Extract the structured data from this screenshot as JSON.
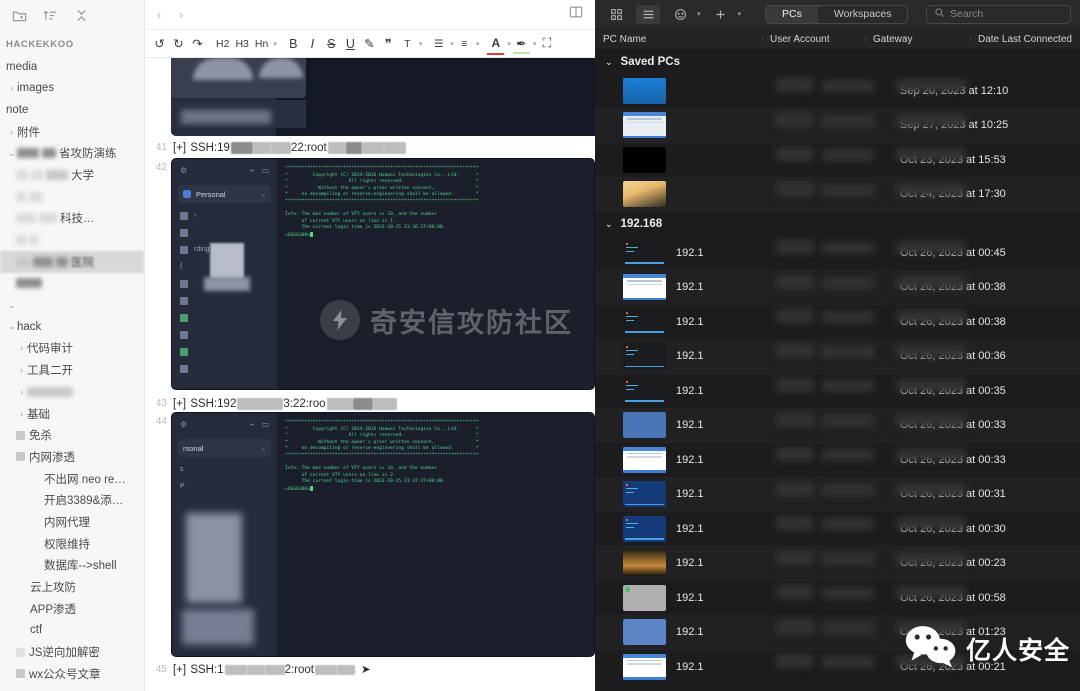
{
  "sidebar": {
    "toolbar_icons": [
      "new-note-icon",
      "sort-icon",
      "collapse-all-icon"
    ],
    "vault_name": "HACKEKKOO",
    "items": [
      {
        "label": "media",
        "depth": 0,
        "chevron": "",
        "kind": "folder"
      },
      {
        "label": "images",
        "depth": 0,
        "chevron": "›",
        "kind": "folder"
      },
      {
        "label": "note",
        "depth": 0,
        "chevron": "",
        "kind": "folder"
      },
      {
        "label": "附件",
        "depth": 0,
        "chevron": "›",
        "kind": "folder"
      },
      {
        "label": "省攻防演练",
        "depth": 0,
        "chevron": "⌄",
        "kind": "folder",
        "redacted_prefix": true
      },
      {
        "label": "大学",
        "depth": 1,
        "chevron": "",
        "kind": "file",
        "redacted_prefix": true
      },
      {
        "label": "",
        "depth": 1,
        "chevron": "",
        "kind": "file",
        "redacted_prefix": true
      },
      {
        "label": "科技…",
        "depth": 1,
        "chevron": "",
        "kind": "file",
        "redacted_prefix": true
      },
      {
        "label": "",
        "depth": 1,
        "chevron": "",
        "kind": "file",
        "redacted_prefix": true
      },
      {
        "label": "医院",
        "depth": 1,
        "chevron": "",
        "kind": "file",
        "redacted_prefix": true,
        "highlight": true
      },
      {
        "label": "",
        "depth": 0,
        "chevron": "⌄",
        "kind": "folder",
        "redacted_prefix": true
      },
      {
        "label": "hack",
        "depth": 0,
        "chevron": "⌄",
        "kind": "folder"
      },
      {
        "label": "代码审计",
        "depth": 1,
        "chevron": "›",
        "kind": "folder"
      },
      {
        "label": "工具二开",
        "depth": 1,
        "chevron": "›",
        "kind": "folder"
      },
      {
        "label": "",
        "depth": 1,
        "chevron": "›",
        "kind": "folder",
        "redacted_prefix": true
      },
      {
        "label": "基础",
        "depth": 1,
        "chevron": "›",
        "kind": "folder"
      },
      {
        "label": "免杀",
        "depth": 1,
        "chevron": "",
        "kind": "note"
      },
      {
        "label": "内网渗透",
        "depth": 1,
        "chevron": "",
        "kind": "note"
      },
      {
        "label": "不出网 neo re…",
        "depth": 2,
        "chevron": "",
        "kind": "note"
      },
      {
        "label": "开启3389&添…",
        "depth": 2,
        "chevron": "",
        "kind": "note"
      },
      {
        "label": "内网代理",
        "depth": 2,
        "chevron": "",
        "kind": "note"
      },
      {
        "label": "权限维持",
        "depth": 2,
        "chevron": "",
        "kind": "note"
      },
      {
        "label": "数据库-->shell",
        "depth": 2,
        "chevron": "",
        "kind": "note"
      },
      {
        "label": "云上攻防",
        "depth": 1,
        "chevron": "",
        "kind": "note"
      },
      {
        "label": "APP渗透",
        "depth": 1,
        "chevron": "",
        "kind": "note"
      },
      {
        "label": "ctf",
        "depth": 1,
        "chevron": "",
        "kind": "note"
      },
      {
        "label": "JS逆向加解密",
        "depth": 1,
        "chevron": "",
        "kind": "note"
      },
      {
        "label": "wx公众号文章",
        "depth": 1,
        "chevron": "",
        "kind": "note"
      }
    ]
  },
  "editor": {
    "nav": {
      "back": "‹",
      "forward": "›",
      "reading_view_icon": "book-icon"
    },
    "toolbar": [
      {
        "name": "undo-button",
        "glyph": "↺"
      },
      {
        "name": "redo-button",
        "glyph": "↻"
      },
      {
        "name": "clear-format-button",
        "glyph": "↷"
      },
      {
        "name": "heading-2-button",
        "glyph": "H2"
      },
      {
        "name": "heading-3-button",
        "glyph": "H3"
      },
      {
        "name": "heading-n-button",
        "glyph": "Hn"
      },
      {
        "name": "bold-button",
        "glyph": "B"
      },
      {
        "name": "italic-button",
        "glyph": "I"
      },
      {
        "name": "strikethrough-button",
        "glyph": "S"
      },
      {
        "name": "underline-button",
        "glyph": "U"
      },
      {
        "name": "highlight-button",
        "glyph": "✎"
      },
      {
        "name": "quote-button",
        "glyph": "❞"
      },
      {
        "name": "clear-style-button",
        "glyph": "T"
      },
      {
        "name": "bullet-list-button",
        "glyph": "☰"
      },
      {
        "name": "align-button",
        "glyph": "≡"
      },
      {
        "name": "font-color-button",
        "glyph": "A"
      },
      {
        "name": "highlight-color-button",
        "glyph": "✒"
      },
      {
        "name": "fullscreen-button",
        "glyph": "⛶"
      }
    ],
    "lines": [
      {
        "num": "41",
        "prefix": "[+]",
        "text": "SSH:19",
        "port": "22:root"
      },
      {
        "num": "42",
        "type": "image"
      },
      {
        "num": "43",
        "prefix": "[+]",
        "text": "SSH:192",
        "port": "3:22:roo"
      },
      {
        "num": "44",
        "type": "image"
      },
      {
        "num": "45",
        "prefix": "[+]",
        "text": "SSH:1",
        "port": "2:root"
      }
    ],
    "terminal_1": {
      "account_label": "Personal",
      "banner": [
        "**********************************************************************",
        "*         Copyright (C) 2014-2016 Huawei Technologies Co., Ltd.      *",
        "*                      All rights reserved.                          *",
        "*           Without the owner's prior written consent,               *",
        "*     no decompiling or reverse-engineering shall be allowed.        *",
        "**********************************************************************"
      ],
      "info": [
        "Info: The max number of VTY users is 10, and the number",
        "      of current VTY users on line is 1.",
        "      The current login time is 2023-10-25 23:36:27+08:00.",
        "<USG6300>"
      ]
    },
    "terminal_2": {
      "account_label": "rsonal",
      "banner": [
        "**********************************************************************",
        "*         Copyright (C) 2014-2016 Huawei Technologies Co., Ltd.      *",
        "*                      All rights reserved.                          *",
        "*           Without the owner's prior written consent,               *",
        "*     no decompiling or reverse-engineering shall be allowed.        *",
        "**********************************************************************"
      ],
      "info": [
        "Info: The max number of VTY users is 10, and the number",
        "      of current VTY users on line is 2.",
        "      The current login time is 2023-10-25 23:37:37+08:00.",
        "<USG6300>"
      ]
    },
    "watermark": {
      "text": "奇安信攻防社区",
      "icon": "lightning-bolt-icon"
    }
  },
  "pcs_panel": {
    "toolbar": {
      "grid_view_icon": "grid-view-icon",
      "list_view_icon": "list-view-icon",
      "more_icon": "more-circle-icon",
      "add_icon": "plus-icon",
      "tabs": [
        {
          "label": "PCs",
          "active": true
        },
        {
          "label": "Workspaces",
          "active": false
        }
      ],
      "search_placeholder": "Search",
      "search_icon": "search-icon"
    },
    "columns": [
      "PC Name",
      "User Account",
      "Gateway",
      "Date Last Connected"
    ],
    "groups": [
      {
        "name": "Saved PCs",
        "expanded": true,
        "rows": [
          {
            "name": "",
            "date": "Sep 20, 2023 at 12:10",
            "thumb": "th-blue"
          },
          {
            "name": "",
            "date": "Sep 27, 2023 at 10:25",
            "thumb": "th-win"
          },
          {
            "name": "",
            "date": "Oct 23, 2023 at 15:53",
            "thumb": "th-black"
          },
          {
            "name": "",
            "date": "Oct 24, 2023 at 17:30",
            "thumb": "th-anime"
          }
        ]
      },
      {
        "name": "192.168",
        "expanded": true,
        "rows": [
          {
            "name": "192.1",
            "date": "Oct 26, 2023 at 00:45",
            "thumb": "th-dark"
          },
          {
            "name": "192.1",
            "date": "Oct 26, 2023 at 00:38",
            "thumb": "th-white"
          },
          {
            "name": "192.1",
            "date": "Oct 26, 2023 at 00:38",
            "thumb": "th-dark"
          },
          {
            "name": "192.1",
            "date": "Oct 26, 2023 at 00:36",
            "thumb": "th-dark"
          },
          {
            "name": "192.1",
            "date": "Oct 26, 2023 at 00:35",
            "thumb": "th-dark"
          },
          {
            "name": "192.1",
            "date": "Oct 26, 2023 at 00:33",
            "thumb": "th-steel"
          },
          {
            "name": "192.1",
            "date": "Oct 26, 2023 at 00:33",
            "thumb": "th-grid"
          },
          {
            "name": "192.1",
            "date": "Oct 26, 2023 at 00:31",
            "thumb": "th-navy"
          },
          {
            "name": "192.1",
            "date": "Oct 26, 2023 at 00:30",
            "thumb": "th-navy"
          },
          {
            "name": "192.1",
            "date": "Oct 26, 2023 at 00:23",
            "thumb": "th-city"
          },
          {
            "name": "192.1",
            "date": "Oct 26, 2023 at 00:58",
            "thumb": "th-gray"
          },
          {
            "name": "192.1",
            "date": "Oct 26, 2023 at 01:23",
            "thumb": "th-softblue"
          },
          {
            "name": "192.1",
            "date": "Oct 26, 2023 at 00:21",
            "thumb": "th-white"
          }
        ]
      }
    ],
    "watermark": {
      "text": "亿人安全",
      "icon": "wechat-icon"
    }
  }
}
